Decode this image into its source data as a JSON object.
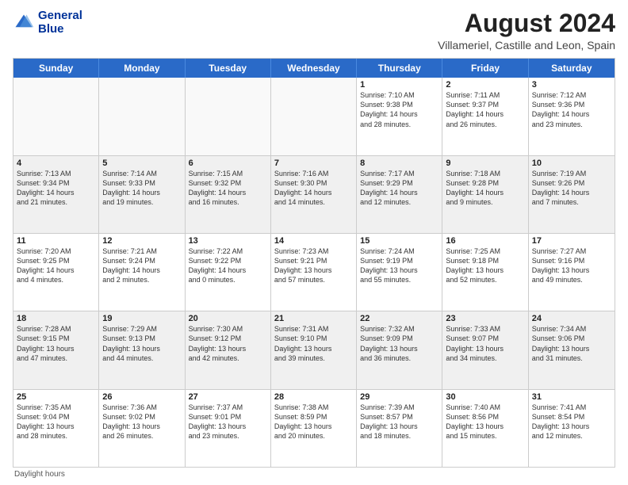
{
  "logo": {
    "line1": "General",
    "line2": "Blue"
  },
  "title": "August 2024",
  "subtitle": "Villameriel, Castille and Leon, Spain",
  "days_of_week": [
    "Sunday",
    "Monday",
    "Tuesday",
    "Wednesday",
    "Thursday",
    "Friday",
    "Saturday"
  ],
  "footer": "Daylight hours",
  "weeks": [
    [
      {
        "day": "",
        "content": ""
      },
      {
        "day": "",
        "content": ""
      },
      {
        "day": "",
        "content": ""
      },
      {
        "day": "",
        "content": ""
      },
      {
        "day": "1",
        "content": "Sunrise: 7:10 AM\nSunset: 9:38 PM\nDaylight: 14 hours\nand 28 minutes."
      },
      {
        "day": "2",
        "content": "Sunrise: 7:11 AM\nSunset: 9:37 PM\nDaylight: 14 hours\nand 26 minutes."
      },
      {
        "day": "3",
        "content": "Sunrise: 7:12 AM\nSunset: 9:36 PM\nDaylight: 14 hours\nand 23 minutes."
      }
    ],
    [
      {
        "day": "4",
        "content": "Sunrise: 7:13 AM\nSunset: 9:34 PM\nDaylight: 14 hours\nand 21 minutes."
      },
      {
        "day": "5",
        "content": "Sunrise: 7:14 AM\nSunset: 9:33 PM\nDaylight: 14 hours\nand 19 minutes."
      },
      {
        "day": "6",
        "content": "Sunrise: 7:15 AM\nSunset: 9:32 PM\nDaylight: 14 hours\nand 16 minutes."
      },
      {
        "day": "7",
        "content": "Sunrise: 7:16 AM\nSunset: 9:30 PM\nDaylight: 14 hours\nand 14 minutes."
      },
      {
        "day": "8",
        "content": "Sunrise: 7:17 AM\nSunset: 9:29 PM\nDaylight: 14 hours\nand 12 minutes."
      },
      {
        "day": "9",
        "content": "Sunrise: 7:18 AM\nSunset: 9:28 PM\nDaylight: 14 hours\nand 9 minutes."
      },
      {
        "day": "10",
        "content": "Sunrise: 7:19 AM\nSunset: 9:26 PM\nDaylight: 14 hours\nand 7 minutes."
      }
    ],
    [
      {
        "day": "11",
        "content": "Sunrise: 7:20 AM\nSunset: 9:25 PM\nDaylight: 14 hours\nand 4 minutes."
      },
      {
        "day": "12",
        "content": "Sunrise: 7:21 AM\nSunset: 9:24 PM\nDaylight: 14 hours\nand 2 minutes."
      },
      {
        "day": "13",
        "content": "Sunrise: 7:22 AM\nSunset: 9:22 PM\nDaylight: 14 hours\nand 0 minutes."
      },
      {
        "day": "14",
        "content": "Sunrise: 7:23 AM\nSunset: 9:21 PM\nDaylight: 13 hours\nand 57 minutes."
      },
      {
        "day": "15",
        "content": "Sunrise: 7:24 AM\nSunset: 9:19 PM\nDaylight: 13 hours\nand 55 minutes."
      },
      {
        "day": "16",
        "content": "Sunrise: 7:25 AM\nSunset: 9:18 PM\nDaylight: 13 hours\nand 52 minutes."
      },
      {
        "day": "17",
        "content": "Sunrise: 7:27 AM\nSunset: 9:16 PM\nDaylight: 13 hours\nand 49 minutes."
      }
    ],
    [
      {
        "day": "18",
        "content": "Sunrise: 7:28 AM\nSunset: 9:15 PM\nDaylight: 13 hours\nand 47 minutes."
      },
      {
        "day": "19",
        "content": "Sunrise: 7:29 AM\nSunset: 9:13 PM\nDaylight: 13 hours\nand 44 minutes."
      },
      {
        "day": "20",
        "content": "Sunrise: 7:30 AM\nSunset: 9:12 PM\nDaylight: 13 hours\nand 42 minutes."
      },
      {
        "day": "21",
        "content": "Sunrise: 7:31 AM\nSunset: 9:10 PM\nDaylight: 13 hours\nand 39 minutes."
      },
      {
        "day": "22",
        "content": "Sunrise: 7:32 AM\nSunset: 9:09 PM\nDaylight: 13 hours\nand 36 minutes."
      },
      {
        "day": "23",
        "content": "Sunrise: 7:33 AM\nSunset: 9:07 PM\nDaylight: 13 hours\nand 34 minutes."
      },
      {
        "day": "24",
        "content": "Sunrise: 7:34 AM\nSunset: 9:06 PM\nDaylight: 13 hours\nand 31 minutes."
      }
    ],
    [
      {
        "day": "25",
        "content": "Sunrise: 7:35 AM\nSunset: 9:04 PM\nDaylight: 13 hours\nand 28 minutes."
      },
      {
        "day": "26",
        "content": "Sunrise: 7:36 AM\nSunset: 9:02 PM\nDaylight: 13 hours\nand 26 minutes."
      },
      {
        "day": "27",
        "content": "Sunrise: 7:37 AM\nSunset: 9:01 PM\nDaylight: 13 hours\nand 23 minutes."
      },
      {
        "day": "28",
        "content": "Sunrise: 7:38 AM\nSunset: 8:59 PM\nDaylight: 13 hours\nand 20 minutes."
      },
      {
        "day": "29",
        "content": "Sunrise: 7:39 AM\nSunset: 8:57 PM\nDaylight: 13 hours\nand 18 minutes."
      },
      {
        "day": "30",
        "content": "Sunrise: 7:40 AM\nSunset: 8:56 PM\nDaylight: 13 hours\nand 15 minutes."
      },
      {
        "day": "31",
        "content": "Sunrise: 7:41 AM\nSunset: 8:54 PM\nDaylight: 13 hours\nand 12 minutes."
      }
    ]
  ]
}
